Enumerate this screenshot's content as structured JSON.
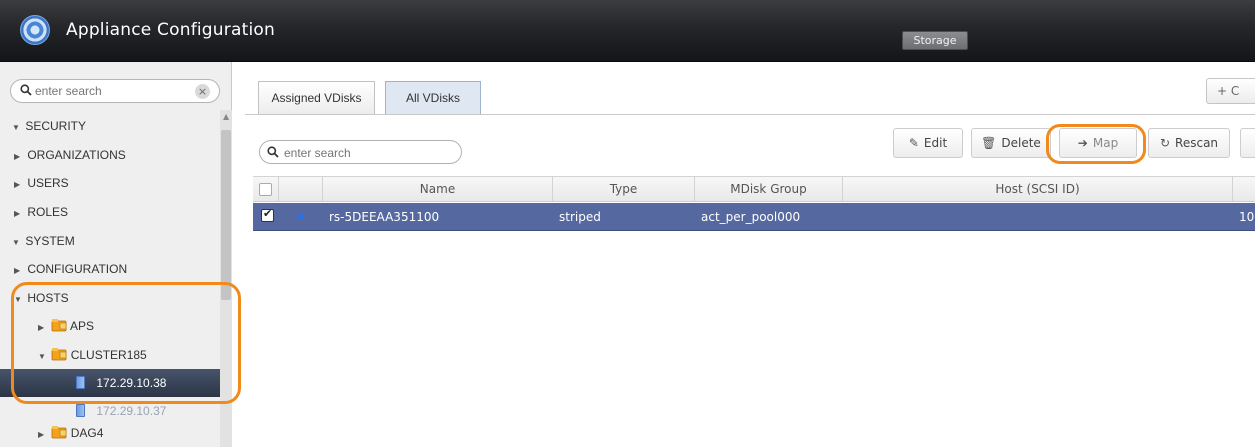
{
  "app": {
    "title": "Appliance Configuration",
    "mode_button": "Storage"
  },
  "sidebar": {
    "search_placeholder": "enter search",
    "clear_glyph": "×",
    "items": [
      {
        "label": "SECURITY",
        "arrow": "▼"
      },
      {
        "label": "ORGANIZATIONS",
        "arrow": "▶"
      },
      {
        "label": "USERS",
        "arrow": "▶"
      },
      {
        "label": "ROLES",
        "arrow": "▶"
      },
      {
        "label": "SYSTEM",
        "arrow": "▼"
      },
      {
        "label": "CONFIGURATION",
        "arrow": "▶"
      },
      {
        "label": "HOSTS",
        "arrow": "▼"
      },
      {
        "label": "APS",
        "arrow": "▶"
      },
      {
        "label": "CLUSTER185",
        "arrow": "▼"
      },
      {
        "label": "172.29.10.38"
      },
      {
        "label": "172.29.10.37"
      },
      {
        "label": "DAG4",
        "arrow": "▶"
      }
    ]
  },
  "tabs": [
    {
      "label": "Assigned VDisks"
    },
    {
      "label": "All VDisks"
    }
  ],
  "create_button": "+ C",
  "main_search_placeholder": "enter search",
  "toolbar": {
    "edit": "Edit",
    "delete": "Delete",
    "map": "Map",
    "rescan": "Rescan"
  },
  "table": {
    "columns": [
      "Name",
      "Type",
      "MDisk Group",
      "Host (SCSI ID)"
    ],
    "rows": [
      {
        "name": "rs-5DEEAA351100",
        "type": "striped",
        "mdisk_group": "act_per_pool000",
        "host": "",
        "extra": "10."
      }
    ]
  },
  "colors": {
    "accent": "#f08a1c",
    "selection": "#5569a0",
    "header": "#24262a"
  }
}
